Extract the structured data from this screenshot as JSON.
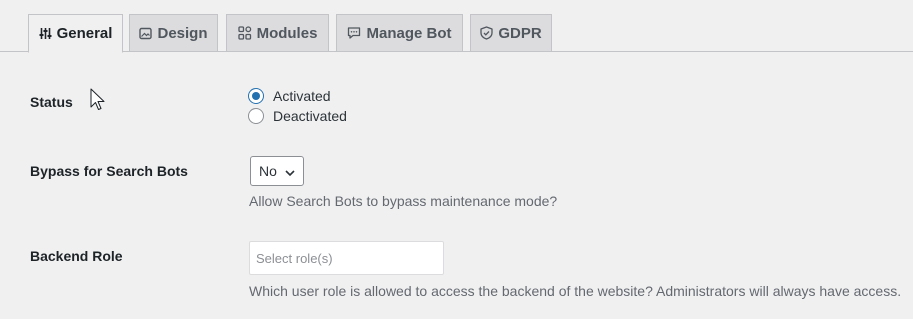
{
  "tabs": [
    {
      "label": "General",
      "icon": "sliders-icon",
      "active": true
    },
    {
      "label": "Design",
      "icon": "image-icon",
      "active": false
    },
    {
      "label": "Modules",
      "icon": "modules-icon",
      "active": false
    },
    {
      "label": "Manage Bot",
      "icon": "chat-icon",
      "active": false
    },
    {
      "label": "GDPR",
      "icon": "shield-icon",
      "active": false
    }
  ],
  "status": {
    "label": "Status",
    "options": [
      {
        "label": "Activated",
        "checked": true
      },
      {
        "label": "Deactivated",
        "checked": false
      }
    ]
  },
  "bypass": {
    "label": "Bypass for Search Bots",
    "selected": "No",
    "description": "Allow Search Bots to bypass maintenance mode?"
  },
  "backend_role": {
    "label": "Backend Role",
    "placeholder": "Select role(s)",
    "description": "Which user role is allowed to access the backend of the website? Administrators will always have access."
  },
  "colors": {
    "accent": "#2271b1",
    "background": "#f0f0f1",
    "tab_inactive": "#dcdcde"
  }
}
